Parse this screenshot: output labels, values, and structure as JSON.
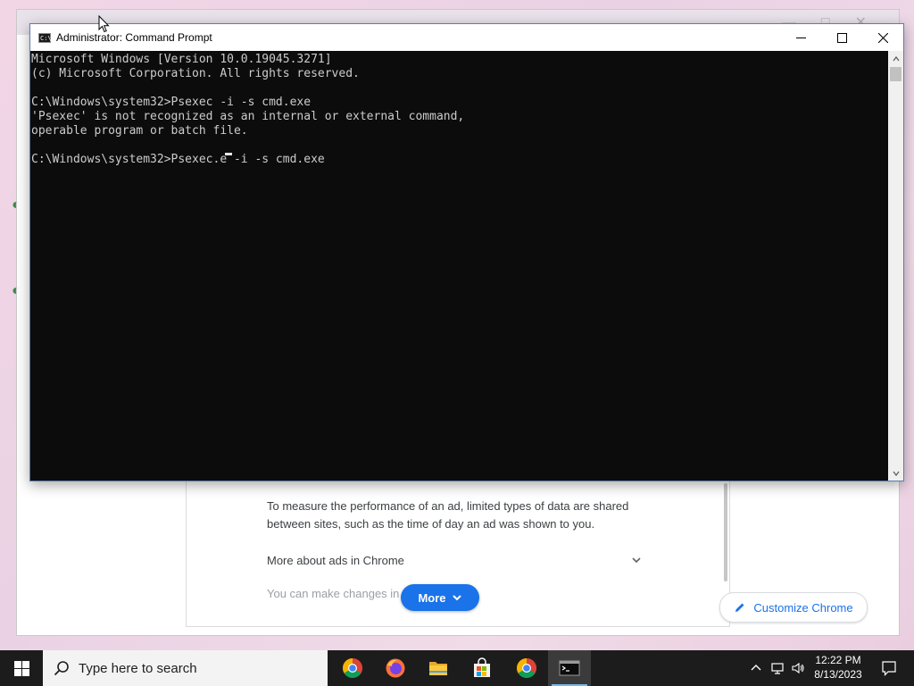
{
  "chrome": {
    "ads_paragraph": "To measure the performance of an ad, limited types of data are shared between sites, such as the time of day an ad was shown to you.",
    "more_about_label": "More about ads in Chrome",
    "changes_text": "You can make changes in Chro",
    "more_button_label": "More",
    "customize_label": "Customize Chrome",
    "accent_color": "#1a73e8"
  },
  "cmd": {
    "title": "Administrator: Command Prompt",
    "lines": [
      "Microsoft Windows [Version 10.0.19045.3271]",
      "(c) Microsoft Corporation. All rights reserved.",
      "",
      "C:\\Windows\\system32>Psexec -i -s cmd.exe",
      "'Psexec' is not recognized as an internal or external command,",
      "operable program or batch file.",
      "",
      "C:\\Windows\\system32>Psexec.e -i -s cmd.exe"
    ],
    "controls": [
      "minimize-icon",
      "maximize-icon",
      "close-icon"
    ]
  },
  "taskbar": {
    "search_placeholder": "Type here to search",
    "apps": [
      "chrome-icon",
      "firefox-icon",
      "file-explorer-icon",
      "microsoft-store-icon",
      "chrome-icon",
      "command-prompt-icon"
    ],
    "time": "12:22 PM",
    "date": "8/13/2023"
  }
}
